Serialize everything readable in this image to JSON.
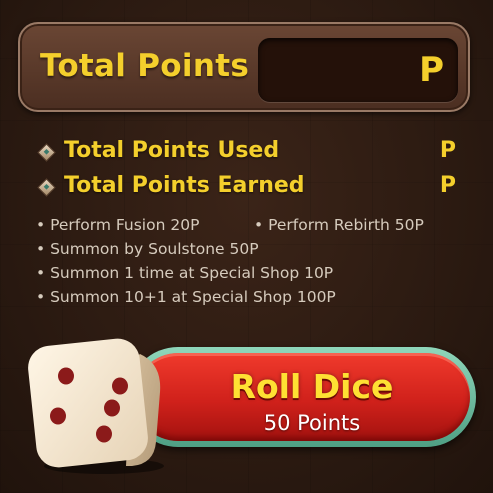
{
  "header": {
    "title": "Total Points",
    "points_value": "",
    "points_unit": "P"
  },
  "stats": [
    {
      "label": "Total Points Used",
      "value": "",
      "unit": "P"
    },
    {
      "label": "Total Points Earned",
      "value": "",
      "unit": "P"
    }
  ],
  "rules": [
    [
      "• Perform Fusion 20P",
      "• Perform Rebirth 50P"
    ],
    [
      "• Summon by Soulstone 50P"
    ],
    [
      "• Summon 1 time at Special Shop  10P"
    ],
    [
      "• Summon 10+1 at Special Shop 100P"
    ]
  ],
  "roll_button": {
    "label": "Roll Dice",
    "cost": "50 Points"
  },
  "dice_icon": "dice-five-icon",
  "colors": {
    "gold": "#f4cf2c",
    "button_red": "#d0211b",
    "button_rim": "#4f9f84",
    "dice_pip": "#8b1a1a"
  }
}
